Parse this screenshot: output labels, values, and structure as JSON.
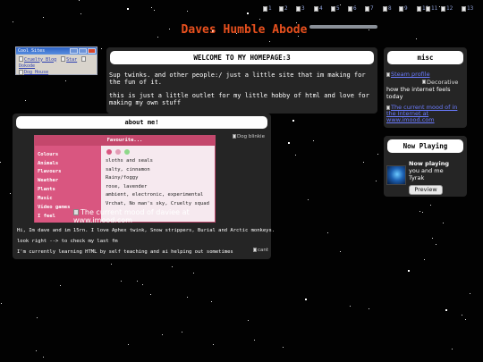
{
  "site": {
    "title": "Daves Humble Abode"
  },
  "top_icons": [
    "1",
    "2",
    "3",
    "4",
    "5",
    "6",
    "7",
    "8",
    "9",
    "10",
    "11",
    "12",
    "13"
  ],
  "cool_sites": {
    "window_title": "Cool Sites",
    "links": [
      "Cruelty Blog",
      "Star",
      "Dokode",
      "Dog House"
    ]
  },
  "welcome": {
    "heading": "WELCOME TO MY HOMEPAGE:3",
    "paragraphs": [
      "Sup twinks. and other people:/ just a little site that im making for the fun of it.",
      "this is just a little outlet for my little hobby of html and love for making my own stuff"
    ]
  },
  "about": {
    "heading": "about me!",
    "favourites": {
      "title": "Favourite...",
      "categories": [
        "Colours",
        "Animals",
        "Flavours",
        "Weather",
        "Plants",
        "Music",
        "Video games",
        "I feel"
      ],
      "values": [
        "sloths and seals",
        "salty, cinnamon",
        "Rainy/foggy",
        "rose, lavender",
        "ambient, electronic, experimental",
        "Vrchat, No man's sky, Cruelty squad"
      ],
      "swatch_colors": [
        "#d95680",
        "#e39bb5",
        "#8fd88a"
      ]
    },
    "mood_image_alt": "The current mood of daviee at www.imood.com",
    "blinkie_alt": "Dog blinkie",
    "lines": [
      "Hi, Im dave and im 15rn. I love Aphex twink, Snow strippers, Burial and Arctic monkeys.",
      "look right --> to check my last fm",
      "I'm currently learning HTML by self teaching and ai helping out sometimes"
    ],
    "cant_alt": "cant"
  },
  "misc": {
    "heading": "misc",
    "steam_link": "Steam profile",
    "decorative_alt": "Decorative",
    "caption": "how the internet feels today",
    "mood_link": "The current mood of in the Internet at www.imood.com"
  },
  "now_playing": {
    "heading": "Now Playing",
    "label": "Now playing",
    "track": "you and me",
    "artist": "Tyrak",
    "preview_label": "Preview"
  }
}
